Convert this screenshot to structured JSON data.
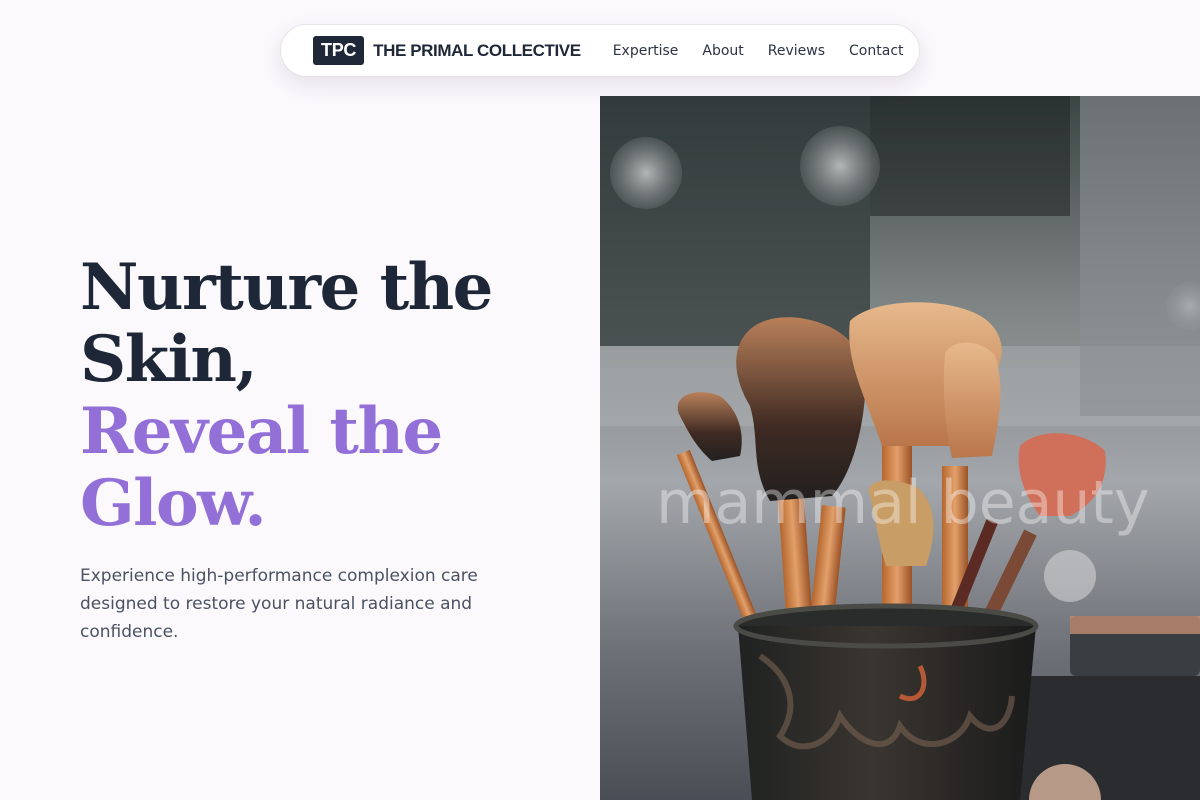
{
  "nav": {
    "brand_mark": "TPC",
    "brand_name": "THE PRIMAL COLLECTIVE",
    "links": [
      {
        "label": "Expertise"
      },
      {
        "label": "About"
      },
      {
        "label": "Reviews"
      },
      {
        "label": "Contact"
      }
    ]
  },
  "hero": {
    "title_line1": "Nurture the",
    "title_line2": "Skin,",
    "accent_line1": "Reveal the",
    "accent_line2": "Glow.",
    "subtitle": "Experience high-performance complexion care designed to restore your natural radiance and confidence.",
    "image_watermark": "mammal beauty"
  },
  "colors": {
    "background": "#fbf9fc",
    "dark_text": "#1e2738",
    "accent": "#9270d8",
    "body_text": "#4a5262",
    "brand_badge": "#1f2838"
  },
  "image": {
    "subject": "makeup-brushes-in-cup-photo"
  }
}
